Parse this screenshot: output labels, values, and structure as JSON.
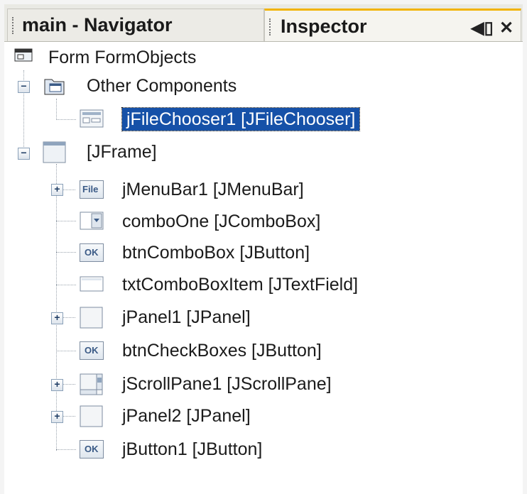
{
  "tabs": [
    {
      "label": "main - Navigator",
      "active": false
    },
    {
      "label": "Inspector",
      "active": true
    }
  ],
  "tab_controls": {
    "minimize_glyph": "◀▯",
    "close_glyph": "✕"
  },
  "tree": {
    "root": {
      "label": "Form FormObjects",
      "icon": "form-icon"
    },
    "other_components": {
      "label": "Other Components",
      "icon": "folder-components-icon",
      "expanded": true
    },
    "file_chooser": {
      "label": "jFileChooser1 [JFileChooser]",
      "icon": "file-chooser-icon",
      "selected": true
    },
    "jframe": {
      "label": "[JFrame]",
      "icon": "frame-icon",
      "expanded": true
    },
    "children": [
      {
        "label": "jMenuBar1 [JMenuBar]",
        "icon": "menubar-icon",
        "icon_text": "File",
        "expandable": true
      },
      {
        "label": "comboOne [JComboBox]",
        "icon": "combobox-icon",
        "expandable": false
      },
      {
        "label": "btnComboBox [JButton]",
        "icon": "button-icon",
        "icon_text": "OK",
        "expandable": false
      },
      {
        "label": "txtComboBoxItem [JTextField]",
        "icon": "textfield-icon",
        "expandable": false
      },
      {
        "label": "jPanel1 [JPanel]",
        "icon": "panel-icon",
        "expandable": true
      },
      {
        "label": "btnCheckBoxes [JButton]",
        "icon": "button-icon",
        "icon_text": "OK",
        "expandable": false
      },
      {
        "label": "jScrollPane1 [JScrollPane]",
        "icon": "scrollpane-icon",
        "expandable": true
      },
      {
        "label": "jPanel2 [JPanel]",
        "icon": "panel-icon",
        "expandable": true
      },
      {
        "label": "jButton1 [JButton]",
        "icon": "button-icon",
        "icon_text": "OK",
        "expandable": false
      }
    ]
  },
  "colors": {
    "selection": "#1651a8",
    "tab_accent": "#f2b300"
  }
}
